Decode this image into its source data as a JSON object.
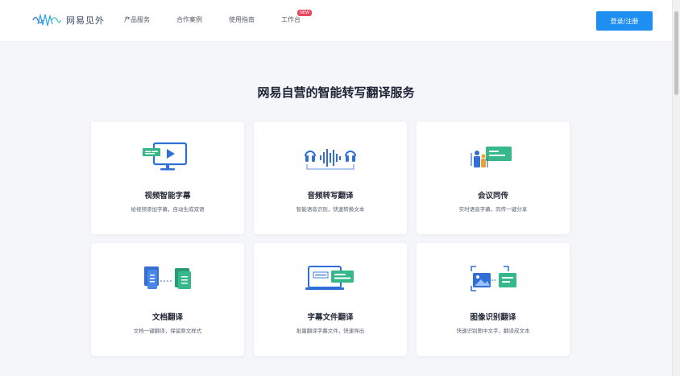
{
  "header": {
    "logo_text": "网易见外",
    "nav": [
      {
        "label": "产品服务"
      },
      {
        "label": "合作案例"
      },
      {
        "label": "使用指南"
      },
      {
        "label": "工作台",
        "badge": "NEW"
      }
    ],
    "login_label": "登录/注册"
  },
  "main": {
    "title": "网易自营的智能转写翻译服务",
    "cards": [
      {
        "title": "视频智能字幕",
        "desc": "给视频添加字幕，自动生成双语",
        "icon": "video-subtitle-icon"
      },
      {
        "title": "音频转写翻译",
        "desc": "智能语音识别，快速转换文本",
        "icon": "audio-waveform-icon"
      },
      {
        "title": "会议同传",
        "desc": "实时语音字幕，同传一键分享",
        "icon": "meeting-interpret-icon"
      },
      {
        "title": "文档翻译",
        "desc": "文档一键翻译，保留原文样式",
        "icon": "document-translate-icon"
      },
      {
        "title": "字幕文件翻译",
        "desc": "批量翻译字幕文件，快速导出",
        "icon": "subtitle-file-icon"
      },
      {
        "title": "图像识别翻译",
        "desc": "快速识别图中文字，翻译成文本",
        "icon": "image-recognition-icon"
      }
    ]
  },
  "colors": {
    "accent": "#1f8ef1",
    "icon_blue": "#2f6fd6",
    "icon_green": "#35b88a",
    "badge": "#e8475c",
    "background": "#f4f6fa"
  }
}
